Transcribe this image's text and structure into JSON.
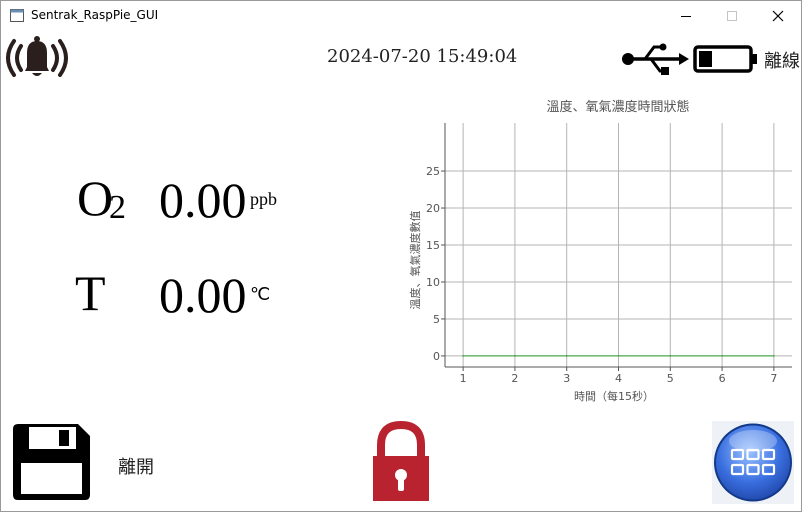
{
  "window": {
    "title": "Sentrak_RaspPie_GUI",
    "controls": [
      "minimize-icon",
      "maximize-icon",
      "close-icon"
    ]
  },
  "header": {
    "datetime": "2024-07-20 15:49:04",
    "alarm_icon": "alarm-bell-icon",
    "usb_icon": "usb-icon",
    "battery_icon": "battery-low-icon",
    "connection_status": "離線"
  },
  "readings": {
    "o2": {
      "label_main": "O",
      "label_sub": "2",
      "value": "0.00",
      "unit": "ppb"
    },
    "temperature": {
      "label": "T",
      "value": "0.00",
      "unit": "℃"
    }
  },
  "footer": {
    "save_icon": "floppy-disk-icon",
    "exit_label": "離開",
    "lock_icon": "padlock-icon",
    "menu_icon": "grid-menu-icon"
  },
  "colors": {
    "lock_red": "#b8232f",
    "menu_blue": "#3a6fe0",
    "series_green": "#2ca02c",
    "grid": "#b4b4b4"
  },
  "chart_data": {
    "type": "line",
    "title": "溫度、氧氣濃度時間狀態",
    "xlabel": "時間（每15秒）",
    "ylabel": "溫度、氧氣濃度數值",
    "x": [
      1,
      2,
      3,
      4,
      5,
      6,
      7
    ],
    "xlim": [
      0.65,
      7.35
    ],
    "ylim": [
      -1.5,
      31.5
    ],
    "xticks": [
      1,
      2,
      3,
      4,
      5,
      6,
      7
    ],
    "yticks": [
      0,
      5,
      10,
      15,
      20,
      25
    ],
    "grid": true,
    "series": [
      {
        "values": [
          0,
          0,
          0,
          0,
          0,
          0,
          0
        ],
        "color": "#2ca02c"
      }
    ]
  }
}
